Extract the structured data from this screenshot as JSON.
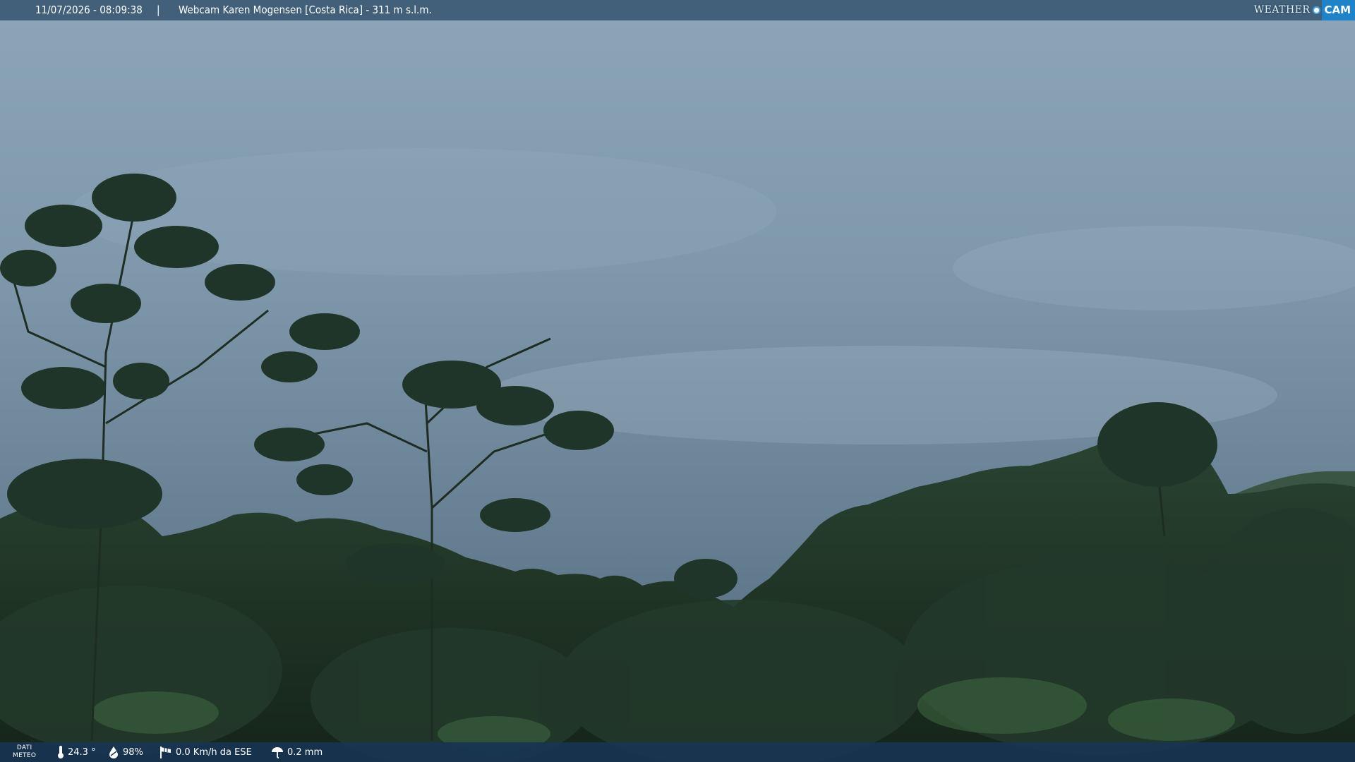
{
  "overlay": {
    "datetime": "11/07/2026 - 08:09:38",
    "separator": "|",
    "title": "Webcam Karen Mogensen [Costa Rica] - 311 m s.l.m.",
    "logo_weather": "WEATHER",
    "logo_cam": "CAM"
  },
  "weather": {
    "label_line1": "DATI",
    "label_line2": "METEO",
    "temperature": "24.3 °",
    "humidity": "98%",
    "wind": "0.0 Km/h da ESE",
    "rain": "0.2 mm"
  },
  "icons": {
    "temperature": "thermometer-icon",
    "humidity": "humidity-drop-icon",
    "wind": "wind-sock-icon",
    "rain": "rain-umbrella-icon"
  },
  "colors": {
    "sky_top": "#8aa3b6",
    "sky_bottom": "#5a7488",
    "forest": "#1f3426",
    "top_bar": "#3c5a73",
    "bottom_bar": "#183452",
    "logo_accent": "#1f83c9"
  }
}
